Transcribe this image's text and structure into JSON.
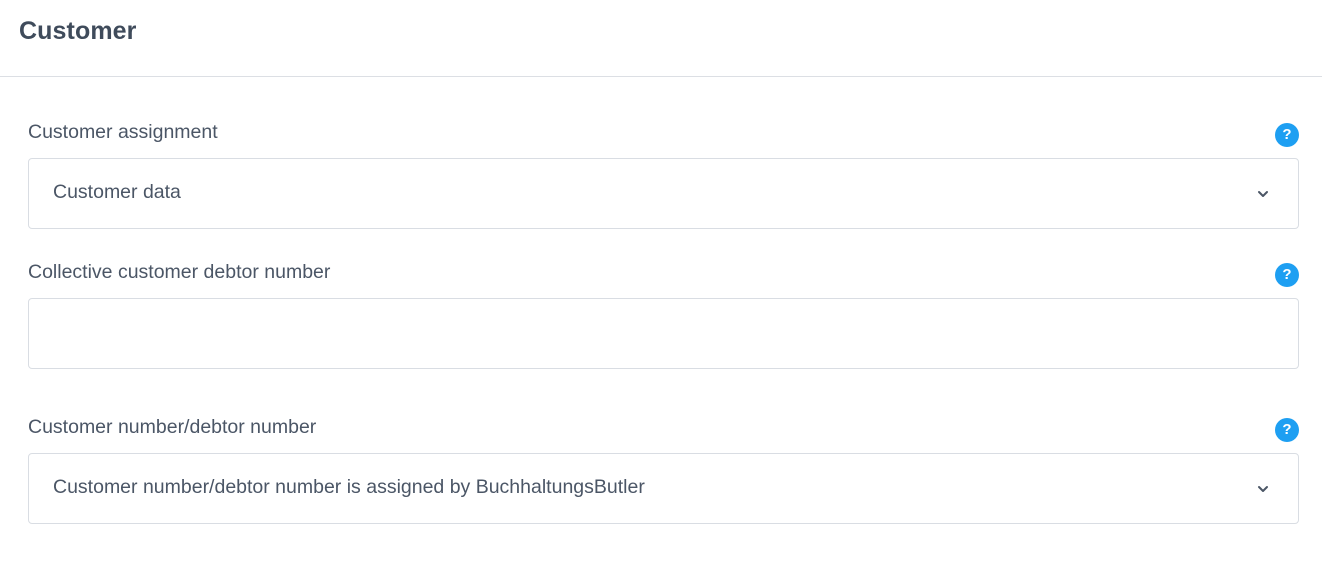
{
  "card": {
    "title": "Customer"
  },
  "fields": {
    "assignment": {
      "label": "Customer assignment",
      "value": "Customer data",
      "help_icon": "question-icon"
    },
    "collective_debtor": {
      "label": "Collective customer debtor number",
      "value": "",
      "placeholder": "",
      "help_icon": "question-icon"
    },
    "debtor_number": {
      "label": "Customer number/debtor number",
      "value": "Customer number/debtor number is assigned by BuchhaltungsButler",
      "help_icon": "question-icon"
    }
  },
  "icons": {
    "help": "?",
    "dropdown": "chevron-down-icon"
  },
  "colors": {
    "accent": "#1e9ff2",
    "text": "#4b5666",
    "title": "#3f4b5b",
    "border": "#d9dde3"
  }
}
